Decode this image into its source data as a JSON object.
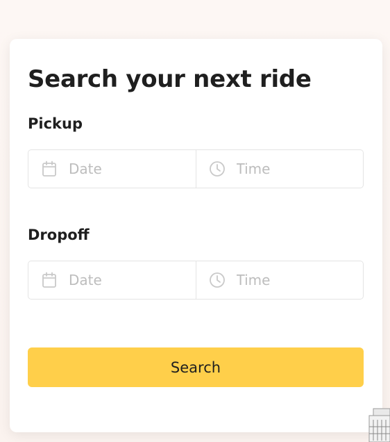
{
  "form": {
    "title": "Search your next ride",
    "pickup": {
      "label": "Pickup",
      "date_placeholder": "Date",
      "time_placeholder": "Time",
      "date_icon": "calendar-icon",
      "time_icon": "clock-icon"
    },
    "dropoff": {
      "label": "Dropoff",
      "date_placeholder": "Date",
      "time_placeholder": "Time",
      "date_icon": "calendar-icon",
      "time_icon": "clock-icon"
    },
    "search_label": "Search"
  },
  "colors": {
    "accent": "#ffcf4a",
    "text": "#1f1f1f",
    "placeholder": "#bdbdbd",
    "icon": "#c9c9c9",
    "border": "#e4e4e4"
  }
}
